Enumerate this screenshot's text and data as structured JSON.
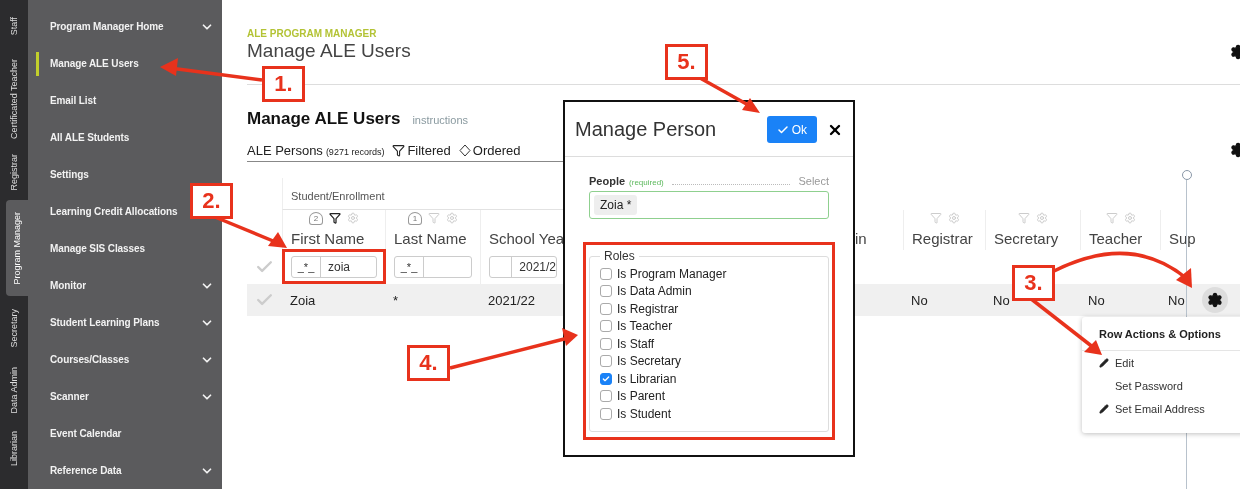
{
  "role_tabs": [
    {
      "label": "Staff",
      "selected": false
    },
    {
      "label": "Certificated Teacher",
      "selected": false
    },
    {
      "label": "Registrar",
      "selected": false
    },
    {
      "label": "Program Manager",
      "selected": true
    },
    {
      "label": "Secretary",
      "selected": false
    },
    {
      "label": "Data Admin",
      "selected": false
    },
    {
      "label": "Librarian",
      "selected": false
    }
  ],
  "sidebar": {
    "items": [
      {
        "label": "Program Manager Home",
        "expandable": true,
        "selected": false
      },
      {
        "label": "Manage ALE Users",
        "expandable": false,
        "selected": true
      },
      {
        "label": "Email List",
        "expandable": false,
        "selected": false
      },
      {
        "label": "All ALE Students",
        "expandable": false,
        "selected": false
      },
      {
        "label": "Settings",
        "expandable": false,
        "selected": false
      },
      {
        "label": "Learning Credit Allocations",
        "expandable": false,
        "selected": false
      },
      {
        "label": "Manage SIS Classes",
        "expandable": false,
        "selected": false
      },
      {
        "label": "Monitor",
        "expandable": true,
        "selected": false
      },
      {
        "label": "Student Learning Plans",
        "expandable": true,
        "selected": false
      },
      {
        "label": "Courses/Classes",
        "expandable": true,
        "selected": false
      },
      {
        "label": "Scanner",
        "expandable": true,
        "selected": false
      },
      {
        "label": "Event Calendar",
        "expandable": false,
        "selected": false
      },
      {
        "label": "Reference Data",
        "expandable": true,
        "selected": false
      }
    ]
  },
  "header": {
    "eyebrow": "ALE PROGRAM MANAGER",
    "title": "Manage ALE Users"
  },
  "section": {
    "title": "Manage ALE Users",
    "link": "instructions"
  },
  "list_bar": {
    "name": "ALE Persons",
    "count": "(9271 records)",
    "filter_label": "Filtered",
    "order_label": "Ordered"
  },
  "table": {
    "group_header": "Student/Enrollment",
    "columns_left": [
      {
        "header": "First Name",
        "sort_rank": "2",
        "filtered": true,
        "filter_prefix": "_*_",
        "filter_value": "zoia"
      },
      {
        "header": "Last Name",
        "sort_rank": "1",
        "filtered": false,
        "filter_prefix": "_*_"
      },
      {
        "header": "School Yea",
        "filter_value": "2021/2"
      }
    ],
    "columns_right": [
      {
        "header": "in"
      },
      {
        "header": "Registrar",
        "filtered": false
      },
      {
        "header": "Secretary",
        "filtered": false
      },
      {
        "header": "Teacher",
        "filtered": false
      },
      {
        "header": "Sup"
      }
    ],
    "rows": [
      {
        "cells_left": [
          "Zoia",
          "*",
          "2021/22"
        ],
        "cells_right": [
          "No",
          "No",
          "No",
          "No"
        ]
      }
    ]
  },
  "dialog": {
    "title": "Manage Person",
    "ok_label": "Ok",
    "people_label": "People",
    "people_hint": "(required)",
    "select_link": "Select",
    "people": [
      "Zoia *"
    ],
    "roles_legend": "Roles",
    "roles": [
      {
        "label": "Is Program Manager",
        "checked": false
      },
      {
        "label": "Is Data Admin",
        "checked": false
      },
      {
        "label": "Is Registrar",
        "checked": false
      },
      {
        "label": "Is Teacher",
        "checked": false
      },
      {
        "label": "Is Staff",
        "checked": false
      },
      {
        "label": "Is Secretary",
        "checked": false
      },
      {
        "label": "Is Librarian",
        "checked": true
      },
      {
        "label": "Is Parent",
        "checked": false
      },
      {
        "label": "Is Student",
        "checked": false
      }
    ]
  },
  "row_menu": {
    "title": "Row Actions & Options",
    "items": [
      {
        "label": "Edit",
        "kind": "pencil"
      },
      {
        "label": "Set Password",
        "kind": "plain"
      },
      {
        "label": "Set Email Address",
        "kind": "pencil"
      }
    ]
  },
  "steps": [
    "1.",
    "2.",
    "3.",
    "4.",
    "5."
  ]
}
